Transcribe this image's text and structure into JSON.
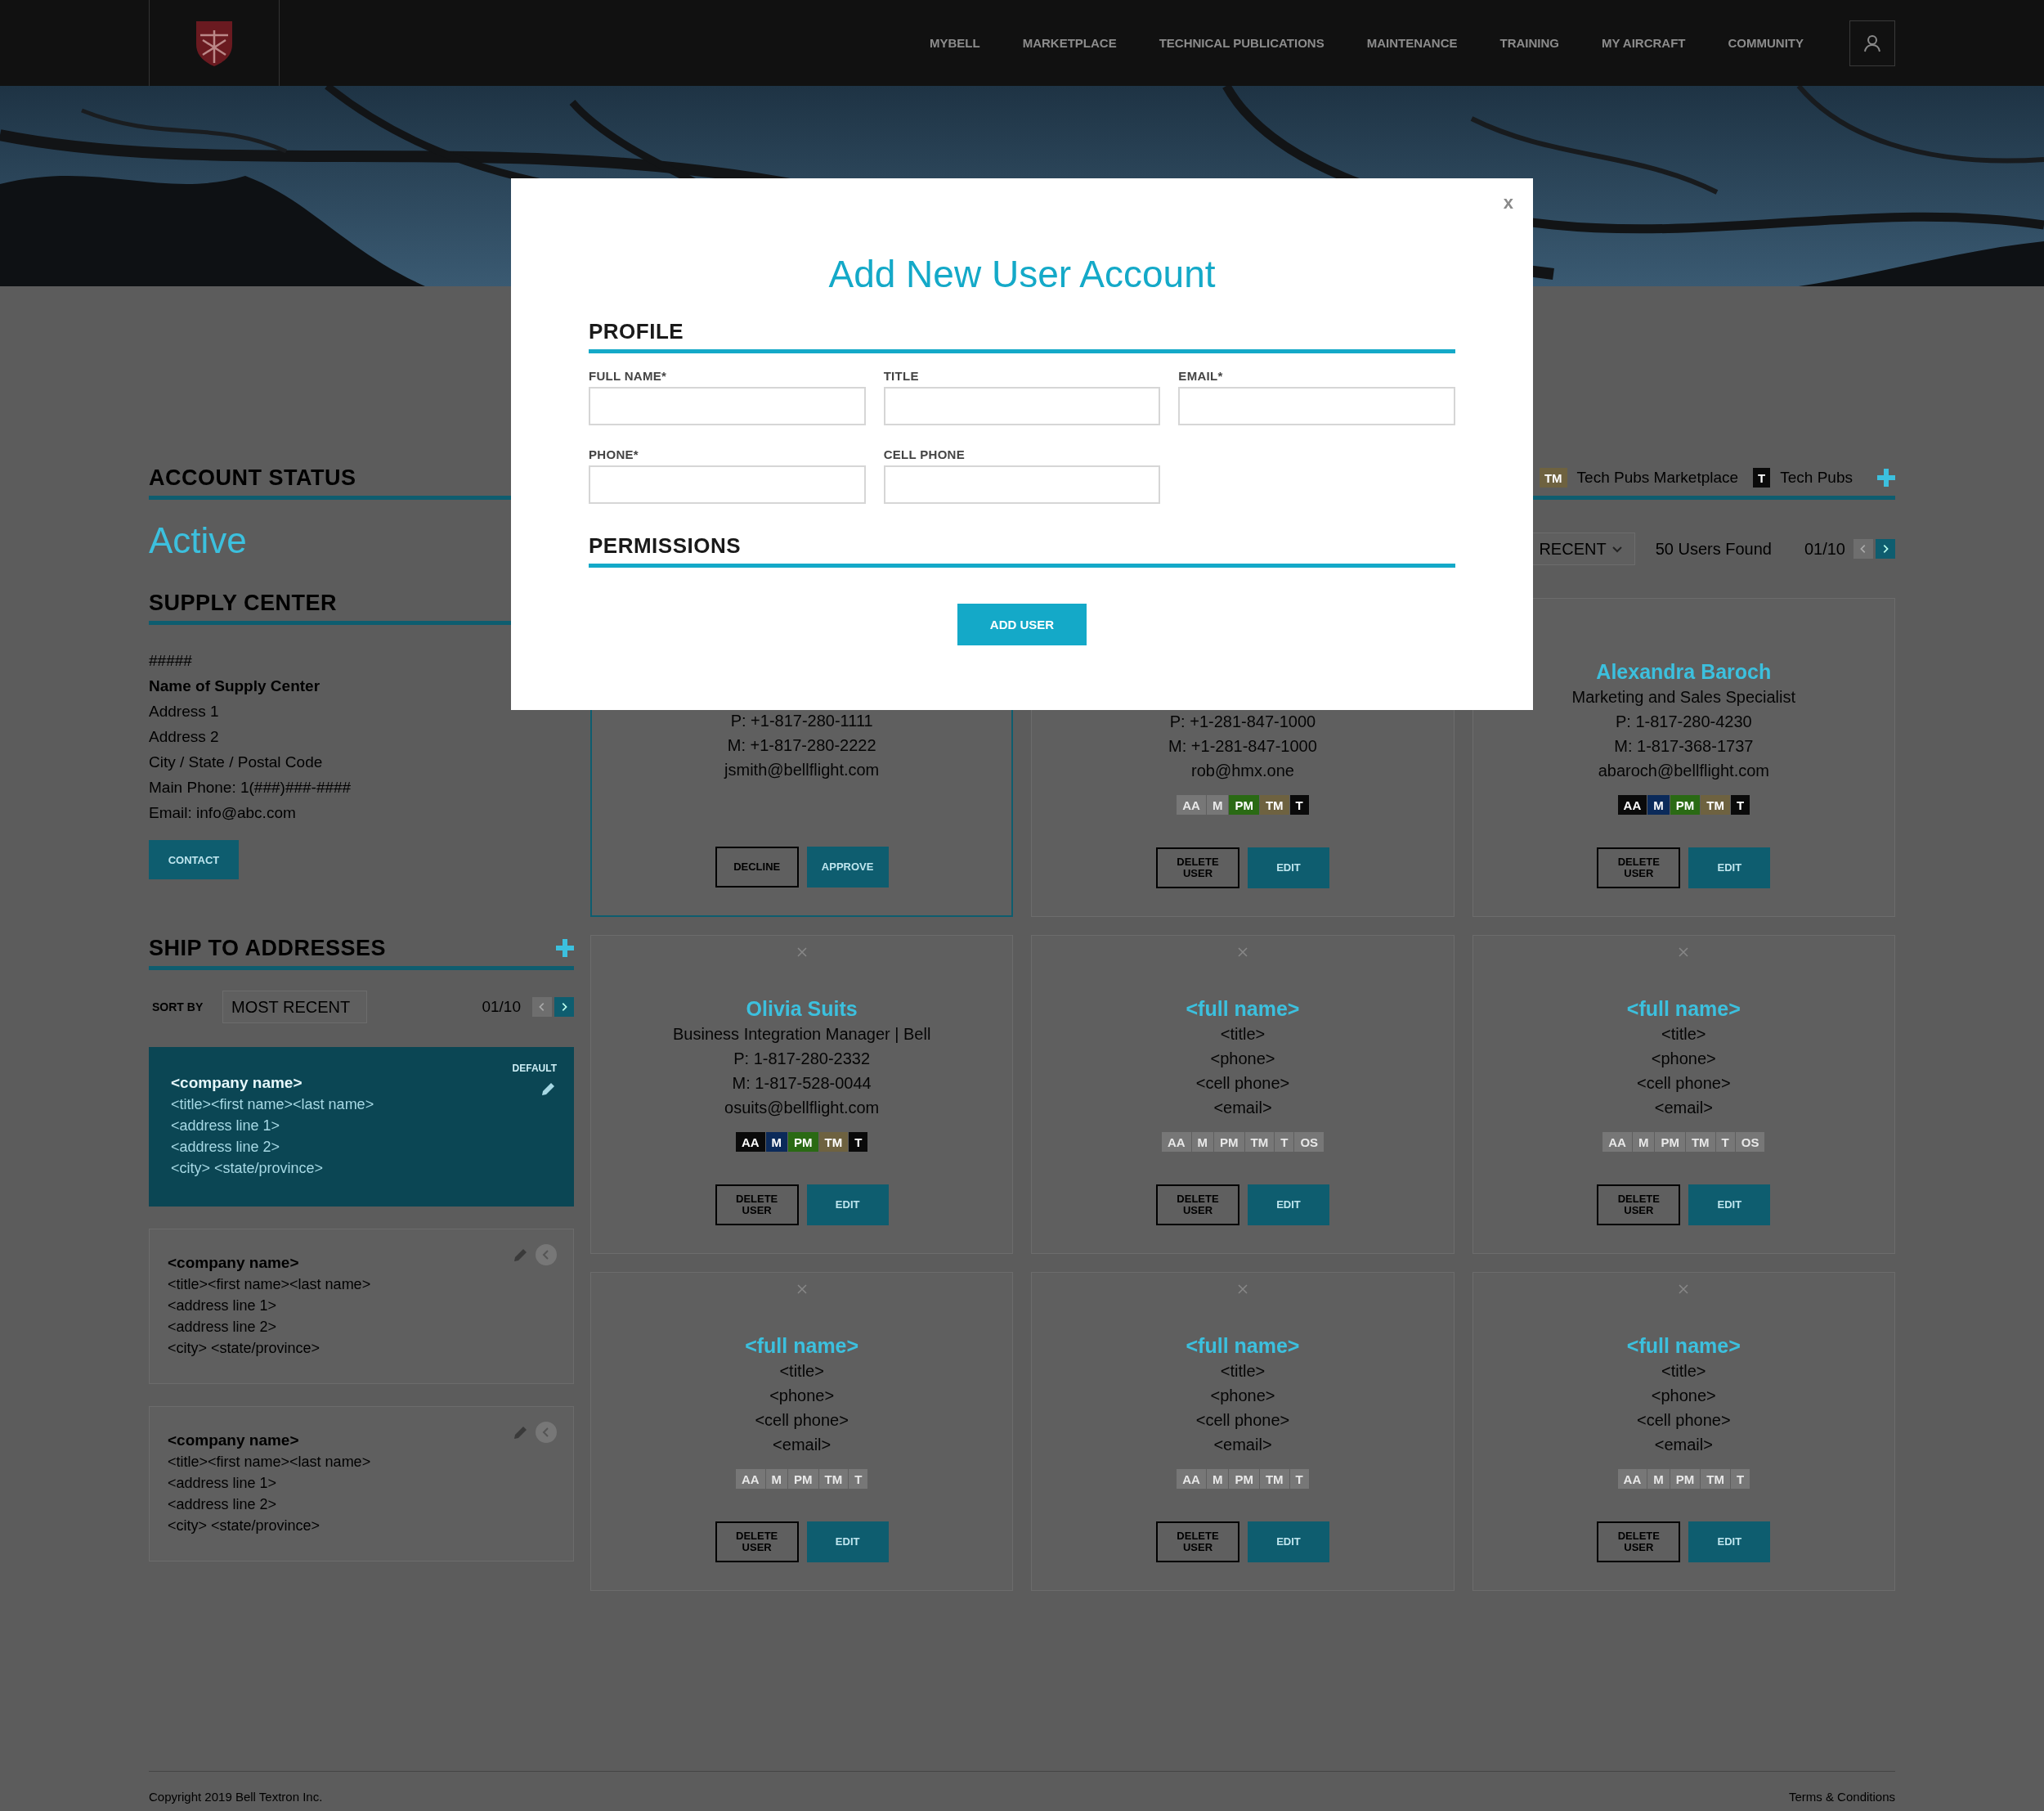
{
  "header": {
    "nav": [
      "MYBELL",
      "MARKETPLACE",
      "TECHNICAL PUBLICATIONS",
      "MAINTENANCE",
      "TRAINING",
      "MY AIRCRAFT",
      "COMMUNITY"
    ]
  },
  "account_status": {
    "heading": "ACCOUNT STATUS",
    "status": "Active"
  },
  "supply_center": {
    "heading": "SUPPLY CENTER",
    "lines": [
      {
        "text": "#####",
        "bold": false
      },
      {
        "text": "Name of Supply Center",
        "bold": true
      },
      {
        "text": "Address 1",
        "bold": false
      },
      {
        "text": "Address 2",
        "bold": false
      },
      {
        "text": "City / State / Postal Code",
        "bold": false
      },
      {
        "text": "Main Phone: 1(###)###-####",
        "bold": false
      },
      {
        "text": "Email: info@abc.com",
        "bold": false
      }
    ],
    "button": "CONTACT"
  },
  "ship_to": {
    "heading": "SHIP TO ADDRESSES",
    "sort_label": "SORT BY",
    "sort_value": "MOST RECENT",
    "page": "01/10",
    "addresses": [
      {
        "company": "<company name>",
        "lines": [
          "<title><first name><last name>",
          "<address line 1>",
          "<address line 2>",
          "<city> <state/province>"
        ],
        "selected": true,
        "default_label": "DEFAULT"
      },
      {
        "company": "<company name>",
        "lines": [
          "<title><first name><last name>",
          "<address line 1>",
          "<address line 2>",
          "<city> <state/province>"
        ],
        "selected": false
      },
      {
        "company": "<company name>",
        "lines": [
          "<title><first name><last name>",
          "<address line 1>",
          "<address line 2>",
          "<city> <state/province>"
        ],
        "selected": false
      }
    ]
  },
  "users": {
    "legend": [
      {
        "code": "TM",
        "label": "Tech Pubs Marketplace",
        "color": "#6e6240"
      },
      {
        "code": "T",
        "label": "Tech Pubs",
        "color": "#0a0a0a"
      }
    ],
    "sort_value": "RECENT",
    "count": "50 Users Found",
    "page": "01/10",
    "card_rows": [
      [
        {
          "kind": "pending",
          "lines": [
            "P: +1-817-280-1111",
            "M: +1-817-280-2222",
            "jsmith@bellflight.com"
          ],
          "buttons": [
            "DECLINE",
            "APPROVE"
          ]
        },
        {
          "kind": "user",
          "lines": [
            "P: +1-281-847-1000",
            "M: +1-281-847-1000",
            "rob@hmx.one"
          ],
          "badges": [
            {
              "code": "AA",
              "active": false
            },
            {
              "code": "M",
              "active": false
            },
            {
              "code": "PM",
              "color": "#2a6a14",
              "active": true
            },
            {
              "code": "TM",
              "color": "#6e6240",
              "active": true
            },
            {
              "code": "T",
              "color": "#0a0a0a",
              "active": true
            }
          ],
          "buttons": [
            "DELETE USER",
            "EDIT"
          ]
        },
        {
          "kind": "user",
          "name": "Alexandra Baroch",
          "lines": [
            "Marketing and Sales Specialist",
            "P: 1-817-280-4230",
            "M: 1-817-368-1737",
            "abaroch@bellflight.com"
          ],
          "badges": [
            {
              "code": "AA",
              "color": "#0a0a0a",
              "active": true
            },
            {
              "code": "M",
              "color": "#0b2a5a",
              "active": true
            },
            {
              "code": "PM",
              "color": "#2a6a14",
              "active": true
            },
            {
              "code": "TM",
              "color": "#6e6240",
              "active": true
            },
            {
              "code": "T",
              "color": "#0a0a0a",
              "active": true
            }
          ],
          "buttons": [
            "DELETE USER",
            "EDIT"
          ]
        }
      ],
      [
        {
          "kind": "user",
          "name": "Olivia Suits",
          "lines": [
            "Business Integration Manager | Bell",
            "P: 1-817-280-2332",
            "M: 1-817-528-0044",
            "osuits@bellflight.com"
          ],
          "badges": [
            {
              "code": "AA",
              "color": "#0a0a0a",
              "active": true
            },
            {
              "code": "M",
              "color": "#0b2a5a",
              "active": true
            },
            {
              "code": "PM",
              "color": "#2a6a14",
              "active": true
            },
            {
              "code": "TM",
              "color": "#6e6240",
              "active": true
            },
            {
              "code": "T",
              "color": "#0a0a0a",
              "active": true
            }
          ],
          "buttons": [
            "DELETE USER",
            "EDIT"
          ]
        },
        {
          "kind": "user",
          "name": "<full name>",
          "lines": [
            "<title>",
            "<phone>",
            "<cell phone>",
            "<email>"
          ],
          "badges": [
            {
              "code": "AA",
              "active": false
            },
            {
              "code": "M",
              "active": false
            },
            {
              "code": "PM",
              "active": false
            },
            {
              "code": "TM",
              "active": false
            },
            {
              "code": "T",
              "active": false
            },
            {
              "code": "OS",
              "active": false
            }
          ],
          "buttons": [
            "DELETE USER",
            "EDIT"
          ]
        },
        {
          "kind": "user",
          "name": "<full name>",
          "lines": [
            "<title>",
            "<phone>",
            "<cell phone>",
            "<email>"
          ],
          "badges": [
            {
              "code": "AA",
              "active": false
            },
            {
              "code": "M",
              "active": false
            },
            {
              "code": "PM",
              "active": false
            },
            {
              "code": "TM",
              "active": false
            },
            {
              "code": "T",
              "active": false
            },
            {
              "code": "OS",
              "active": false
            }
          ],
          "buttons": [
            "DELETE USER",
            "EDIT"
          ]
        }
      ],
      [
        {
          "kind": "user",
          "name": "<full name>",
          "lines": [
            "<title>",
            "<phone>",
            "<cell phone>",
            "<email>"
          ],
          "badges": [
            {
              "code": "AA",
              "active": false
            },
            {
              "code": "M",
              "active": false
            },
            {
              "code": "PM",
              "active": false
            },
            {
              "code": "TM",
              "active": false
            },
            {
              "code": "T",
              "active": false
            }
          ],
          "buttons": [
            "DELETE USER",
            "EDIT"
          ]
        },
        {
          "kind": "user",
          "name": "<full name>",
          "lines": [
            "<title>",
            "<phone>",
            "<cell phone>",
            "<email>"
          ],
          "badges": [
            {
              "code": "AA",
              "active": false
            },
            {
              "code": "M",
              "active": false
            },
            {
              "code": "PM",
              "active": false
            },
            {
              "code": "TM",
              "active": false
            },
            {
              "code": "T",
              "active": false
            }
          ],
          "buttons": [
            "DELETE USER",
            "EDIT"
          ]
        },
        {
          "kind": "user",
          "name": "<full name>",
          "lines": [
            "<title>",
            "<phone>",
            "<cell phone>",
            "<email>"
          ],
          "badges": [
            {
              "code": "AA",
              "active": false
            },
            {
              "code": "M",
              "active": false
            },
            {
              "code": "PM",
              "active": false
            },
            {
              "code": "TM",
              "active": false
            },
            {
              "code": "T",
              "active": false
            }
          ],
          "buttons": [
            "DELETE USER",
            "EDIT"
          ]
        }
      ]
    ]
  },
  "modal": {
    "close": "x",
    "title": "Add New User Account",
    "profile_heading": "PROFILE",
    "fields": [
      {
        "label": "FULL NAME*"
      },
      {
        "label": "TITLE"
      },
      {
        "label": "EMAIL*"
      },
      {
        "label": "PHONE*"
      },
      {
        "label": "CELL PHONE"
      }
    ],
    "permissions_heading": "PERMISSIONS",
    "button": "ADD USER"
  },
  "footer": {
    "copyright": "Copyright 2019 Bell Textron Inc.",
    "link": "Terms & Conditions"
  }
}
